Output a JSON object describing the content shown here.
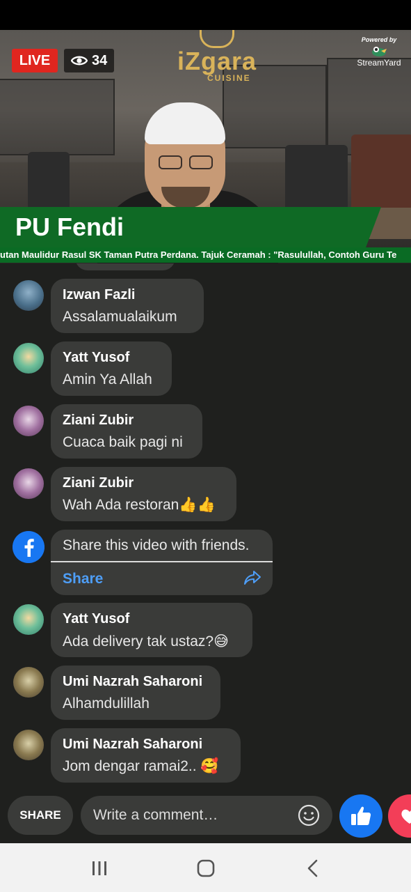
{
  "stream": {
    "live_label": "LIVE",
    "viewer_count": "34",
    "logo_text": "iZgara",
    "logo_subtitle": "CUISINE",
    "streamyard_powered": "Powered by",
    "streamyard_name": "StreamYard",
    "speaker_name": "PU Fendi",
    "ticker_text": "utan Maulidur Rasul SK Taman Putra Perdana. Tajuk Ceramah : \"Rasulullah, Contoh Guru Te"
  },
  "comments": [
    {
      "author": "Izwan Fazli",
      "text": "Assalamualaikum"
    },
    {
      "author": "Yatt Yusof",
      "text": "Amin Ya Allah"
    },
    {
      "author": "Ziani Zubir",
      "text": "Cuaca baik pagi ni"
    },
    {
      "author": "Ziani Zubir",
      "text": "Wah Ada restoran👍👍"
    },
    {
      "author": "Yatt Yusof",
      "text": "Ada delivery tak ustaz?😅"
    },
    {
      "author": "Umi Nazrah Saharoni",
      "text": "Alhamdulillah"
    },
    {
      "author": "Umi Nazrah Saharoni",
      "text": "Jom dengar ramai2.. 🥰"
    }
  ],
  "share_prompt": {
    "text": "Share this video with friends.",
    "link_label": "Share"
  },
  "bottom_bar": {
    "share_label": "SHARE",
    "comment_placeholder": "Write a comment…"
  },
  "colors": {
    "live_red": "#e0261f",
    "banner_green": "#0f6a25",
    "facebook_blue": "#1877f2",
    "link_blue": "#4e9ef7",
    "love_red": "#f33e58"
  },
  "icons": [
    "eye-icon",
    "streamyard-logo-icon",
    "facebook-icon",
    "share-arrow-icon",
    "emoji-icon",
    "like-icon",
    "love-icon",
    "recents-icon",
    "home-icon",
    "back-icon"
  ]
}
